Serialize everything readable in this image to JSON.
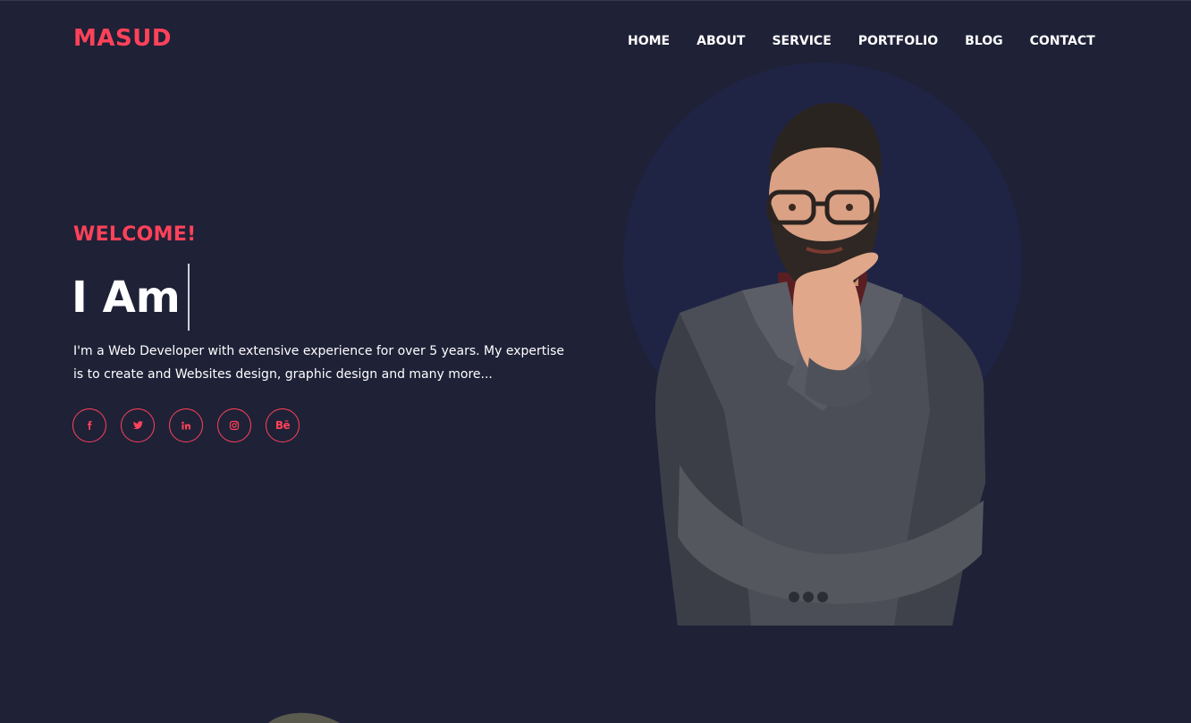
{
  "brand": {
    "logo": "MASUD",
    "accent_color": "#ff4259",
    "background_color": "#1f2137",
    "circle_color": "#1f2444"
  },
  "nav": {
    "items": [
      {
        "label": "HOME"
      },
      {
        "label": "ABOUT"
      },
      {
        "label": "SERVICE"
      },
      {
        "label": "PORTFOLIO"
      },
      {
        "label": "BLOG"
      },
      {
        "label": "CONTACT"
      }
    ]
  },
  "hero": {
    "welcome": "WELCOME!",
    "headline": "I Am",
    "bio": "I'm a Web Developer with extensive experience for over 5 years. My expertise is to create and Websites design, graphic design and many more...",
    "socials": [
      {
        "icon": "facebook-icon"
      },
      {
        "icon": "twitter-icon"
      },
      {
        "icon": "linkedin-icon"
      },
      {
        "icon": "instagram-icon"
      },
      {
        "icon": "behance-icon",
        "text": "Bē"
      }
    ]
  }
}
